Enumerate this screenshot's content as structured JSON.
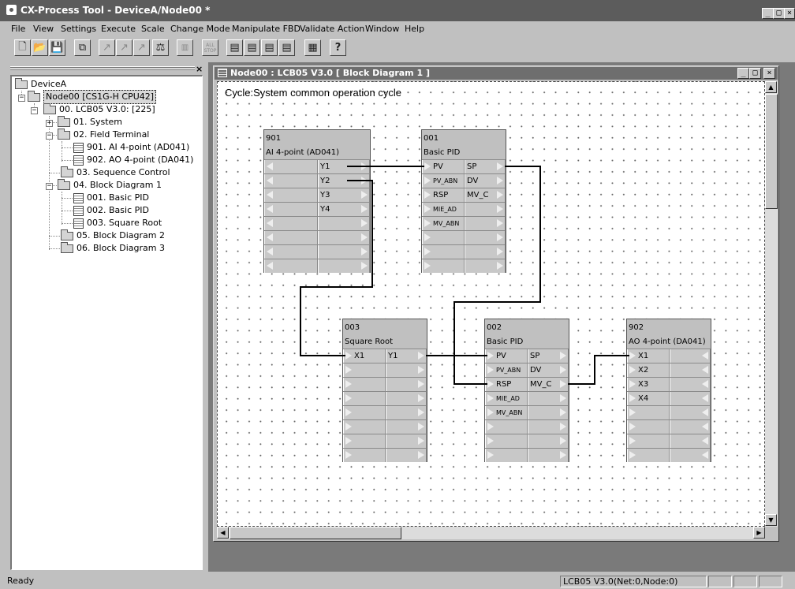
{
  "window": {
    "title": "CX-Process Tool - DeviceA/Node00 *"
  },
  "menu": [
    "File",
    "View",
    "Settings",
    "Execute",
    "Scale",
    "Change Mode",
    "Manipulate FBD",
    "Validate Action",
    "Window",
    "Help"
  ],
  "toolbar": {
    "buttons": [
      "new-file-icon",
      "open-folder-icon",
      "save-icon",
      "copy-windows-icon",
      "arrow-up-icon",
      "arrow-diag-icon",
      "arrow-diag-2-icon",
      "balance-scale-icon",
      "block-diagram-icon",
      "all-stop-icon",
      "table-1-icon",
      "table-2-icon",
      "table-3-icon",
      "table-4-icon",
      "grid-table-icon",
      "help-icon"
    ],
    "all_stop_label": "ALL STOP"
  },
  "tree": {
    "root": "DeviceA",
    "node": "Node00 [CS1G-H CPU42]",
    "lcb": "00. LCB05 V3.0: [225]",
    "items": [
      {
        "label": "01. System"
      },
      {
        "label": "02. Field Terminal"
      },
      {
        "label": "901. AI 4-point (AD041)"
      },
      {
        "label": "902. AO 4-point (DA041)"
      },
      {
        "label": "03. Sequence Control"
      },
      {
        "label": "04. Block Diagram 1"
      },
      {
        "label": "001. Basic PID"
      },
      {
        "label": "002. Basic PID"
      },
      {
        "label": "003. Square Root"
      },
      {
        "label": "05. Block Diagram 2"
      },
      {
        "label": "06. Block Diagram 3"
      }
    ]
  },
  "child_window": {
    "title": "Node00 : LCB05 V3.0 [ Block Diagram 1 ]",
    "cycle_label": "Cycle:System common operation cycle"
  },
  "blocks": [
    {
      "id": "901",
      "name": "AI 4-point (AD041)",
      "left": [
        "",
        "",
        "",
        "",
        "",
        "",
        "",
        ""
      ],
      "right": [
        "Y1",
        "Y2",
        "Y3",
        "Y4",
        "",
        "",
        "",
        ""
      ]
    },
    {
      "id": "001",
      "name": "Basic PID",
      "left": [
        "PV",
        "PV_ABN",
        "RSP",
        "MIE_AD",
        "MV_ABN",
        "",
        "",
        ""
      ],
      "right": [
        "SP",
        "DV",
        "MV_C",
        "",
        "",
        "",
        "",
        ""
      ]
    },
    {
      "id": "003",
      "name": "Square Root",
      "left": [
        "X1",
        "",
        "",
        "",
        "",
        "",
        "",
        ""
      ],
      "right": [
        "Y1",
        "",
        "",
        "",
        "",
        "",
        "",
        ""
      ]
    },
    {
      "id": "002",
      "name": "Basic PID",
      "left": [
        "PV",
        "PV_ABN",
        "RSP",
        "MIE_AD",
        "MV_ABN",
        "",
        "",
        ""
      ],
      "right": [
        "SP",
        "DV",
        "MV_C",
        "",
        "",
        "",
        "",
        ""
      ]
    },
    {
      "id": "902",
      "name": "AO 4-point (DA041)",
      "left": [
        "X1",
        "X2",
        "X3",
        "X4",
        "",
        "",
        "",
        ""
      ],
      "right": [
        "",
        "",
        "",
        "",
        "",
        "",
        "",
        ""
      ]
    }
  ],
  "status": {
    "left": "Ready",
    "node_info": "LCB05 V3.0(Net:0,Node:0)"
  }
}
